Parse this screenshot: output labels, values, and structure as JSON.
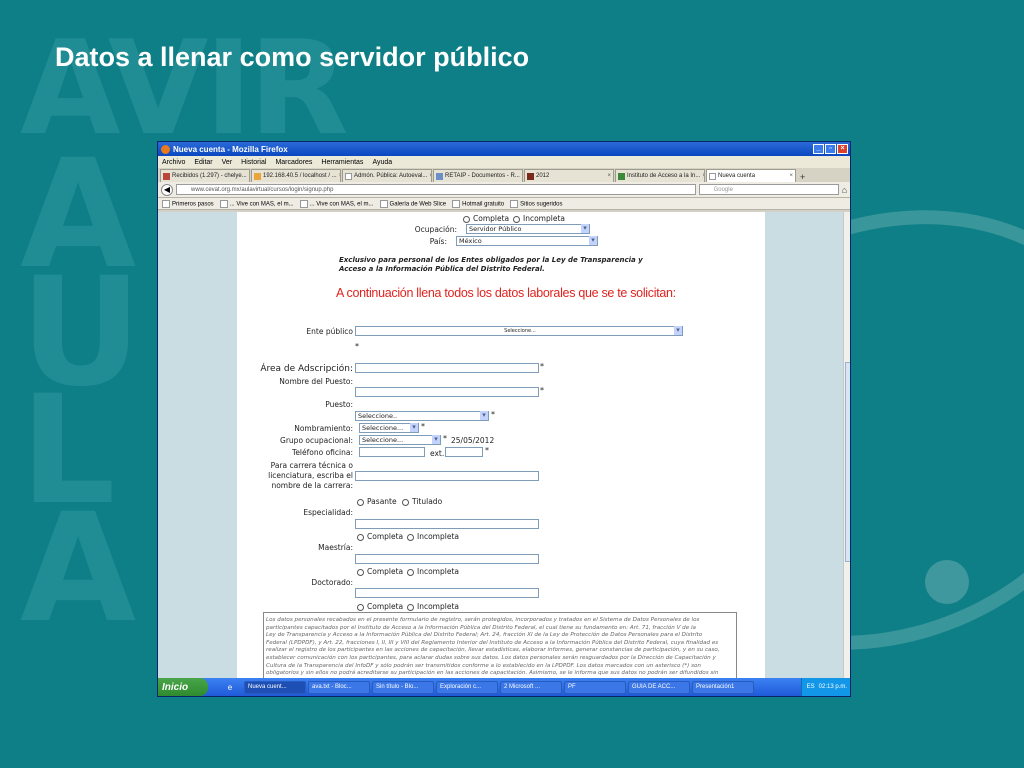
{
  "slide": {
    "title": "Datos a llenar como servidor público",
    "bg_letters": [
      "A",
      "U",
      "L",
      "A"
    ],
    "bg_word": "AVIR"
  },
  "browser": {
    "title": "Nueva cuenta - Mozilla Firefox",
    "menu": [
      "Archivo",
      "Editar",
      "Ver",
      "Historial",
      "Marcadores",
      "Herramientas",
      "Ayuda"
    ],
    "tabs": [
      {
        "label": "Recibidos (1.297) - chelye..."
      },
      {
        "label": "192.168.40.5 / localhost / ..."
      },
      {
        "label": "Admón. Pública: Autoeval..."
      },
      {
        "label": "RETAIP - Documentos - R..."
      },
      {
        "label": "2012"
      },
      {
        "label": "Instituto de Acceso a la In..."
      },
      {
        "label": "Nueva cuenta"
      }
    ],
    "url": "www.cevat.org.mx/aulavirtual/cursos/login/signup.php",
    "search_placeholder": "Google",
    "bookmarks": [
      "Primeros pasos",
      "... Vive con MAS, el m...",
      "... Vive con MAS, el m...",
      "Galería de Web Slice",
      "Hotmail gratuito",
      "Sitios sugeridos"
    ]
  },
  "form": {
    "estudios_top": {
      "completa": "Completa",
      "incompleta": "Incompleta"
    },
    "ocupacion": {
      "label": "Ocupación:",
      "value": "Servidor Público"
    },
    "pais": {
      "label": "País:",
      "value": "México"
    },
    "notice": "Exclusivo para personal de los Entes obligados por la Ley de Transparencia y Acceso a la Información Pública del Distrito Federal.",
    "heading": "A continuación llena todos los datos laborales que se te solicitan:",
    "ente": {
      "label": "Ente público",
      "value": "Seleccione..."
    },
    "area": {
      "label": "Área de Adscripción:"
    },
    "nombre_puesto": {
      "label": "Nombre del Puesto:"
    },
    "puesto": {
      "label": "Puesto:",
      "value": "Seleccione.."
    },
    "nombramiento": {
      "label": "Nombramiento:",
      "value": "Seleccione..."
    },
    "grupo": {
      "label": "Grupo ocupacional:",
      "value": "Seleccione...",
      "date": "25/05/2012"
    },
    "telefono": {
      "label": "Teléfono oficina:",
      "ext": "ext."
    },
    "carrera": {
      "label": "Para carrera técnica o licenciatura, escriba el nombre de la carrera:"
    },
    "carrera_opts": {
      "pasante": "Pasante",
      "titulado": "Titulado"
    },
    "especialidad": {
      "label": "Especialidad:"
    },
    "maestria": {
      "label": "Maestría:"
    },
    "doctorado": {
      "label": "Doctorado:"
    },
    "completa": "Completa",
    "incompleta": "Incompleta",
    "asterisk": "*",
    "legal_lines": [
      "Los datos personales recabados en el presente formulario de registro, serán protegidos, incorporados y tratados en el Sistema de Datos Personales de los",
      "participantes capacitados por el Instituto de Acceso a la Información Pública del Distrito Federal, el cual tiene su fundamento en: Art. 71, fracción V de la",
      "Ley de Transparencia y Acceso a la Información Pública del Distrito Federal; Art. 24, fracción XI de la Ley de Protección de Datos Personales para el Distrito",
      "Federal (LPDPDF), y Art. 22, fracciones I, II, III y VIII del Reglamento Interior del Instituto de Acceso a la Información Pública del Distrito Federal, cuya finalidad es",
      "realizar el registro de los participantes en las acciones de capacitación, llevar estadísticas, elaborar informes, generar constancias de participación, y en su caso,",
      "establecer comunicación con los participantes, para aclarar dudas sobre sus datos. Los datos personales serán resguardados por la Dirección de Capacitación y",
      "Cultura de la Transparencia del InfoDF y sólo podrán ser transmitidos conforme a lo establecido en la LPDPDF. Los datos marcados con un asterisco (*) son",
      "obligatorios y sin ellos no podrá acreditarse su participación en las acciones de capacitación. Asimismo, se le informa que sus datos no podrán ser difundidos sin"
    ]
  },
  "taskbar": {
    "start": "Inicio",
    "items": [
      "Nueva cuent...",
      "ava.txt - Bloc...",
      "Sin título - Blo...",
      "Exploración c...",
      "2 Microsoft ...",
      "PF",
      "GUIA DE ACC...",
      "Presentación1"
    ],
    "lang": "ES",
    "clock": "02:13 p.m."
  }
}
